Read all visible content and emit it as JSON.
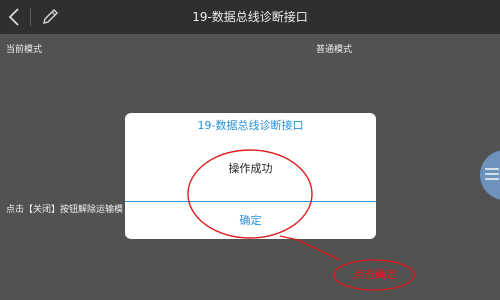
{
  "header": {
    "title": "19-数据总线诊断接口"
  },
  "main": {
    "current_mode_label": "当前模式",
    "normal_mode_label": "普通模式",
    "hint_text": "点击【关闭】按钮解除运输模"
  },
  "dialog": {
    "title": "19-数据总线诊断接口",
    "message": "操作成功",
    "ok_label": "确定"
  },
  "annotation": {
    "text": "点击确定"
  },
  "icons": {
    "back": "chevron-left-icon",
    "edit": "pencil-icon",
    "side": "menu-icon"
  },
  "colors": {
    "topbar": "#2f2f2f",
    "background": "#525252",
    "accent": "#2a92d8",
    "annotation": "#e01c1c"
  }
}
